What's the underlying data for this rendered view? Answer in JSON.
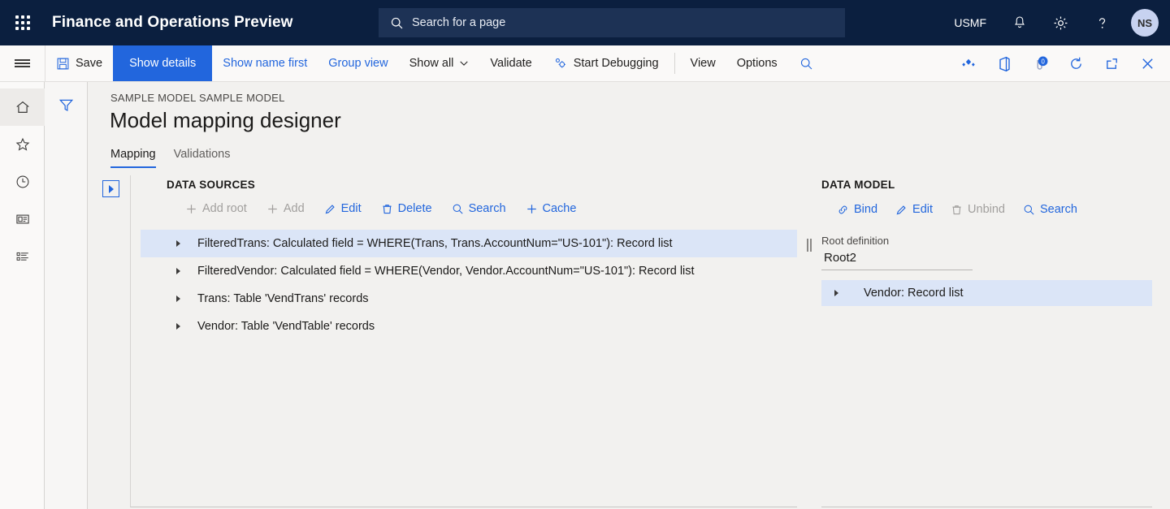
{
  "topbar": {
    "waffle_icon": "app-launcher-icon",
    "app_title": "Finance and Operations Preview",
    "search": {
      "placeholder": "Search for a page",
      "icon": "search-icon"
    },
    "company": "USMF",
    "notifications_icon": "bell-icon",
    "settings_icon": "gear-icon",
    "help_icon": "question-mark-icon",
    "avatar_initials": "NS"
  },
  "commandbar": {
    "menu_icon": "hamburger-menu-icon",
    "save": "Save",
    "show_details": "Show details",
    "show_name_first": "Show name first",
    "group_view": "Group view",
    "show_all": "Show all",
    "validate": "Validate",
    "start_debugging": "Start Debugging",
    "view": "View",
    "options": "Options",
    "search_icon": "search-icon",
    "right_icons": [
      {
        "name": "power-apps-icon"
      },
      {
        "name": "office-app-icon"
      },
      {
        "name": "attachments-icon",
        "badge": "0"
      },
      {
        "name": "refresh-icon"
      },
      {
        "name": "open-in-new-window-icon"
      },
      {
        "name": "close-icon"
      }
    ]
  },
  "navrail": {
    "items": [
      {
        "name": "home-icon",
        "selected": true
      },
      {
        "name": "favorites-star-icon",
        "selected": false
      },
      {
        "name": "recent-clock-icon",
        "selected": false
      },
      {
        "name": "workspaces-icon",
        "selected": false
      },
      {
        "name": "modules-list-icon",
        "selected": false
      }
    ]
  },
  "filterrail": {
    "filter_icon": "filter-funnel-icon"
  },
  "page": {
    "breadcrumb": "SAMPLE MODEL SAMPLE MODEL",
    "title": "Model mapping designer",
    "tabs": [
      {
        "label": "Mapping",
        "selected": true
      },
      {
        "label": "Validations",
        "selected": false
      }
    ]
  },
  "data_sources": {
    "expand_icon": "expand-panel-icon",
    "heading": "DATA SOURCES",
    "toolbar": [
      {
        "label": "Add root",
        "icon": "plus-icon",
        "disabled": true
      },
      {
        "label": "Add",
        "icon": "plus-icon",
        "disabled": true
      },
      {
        "label": "Edit",
        "icon": "pencil-icon",
        "disabled": false
      },
      {
        "label": "Delete",
        "icon": "trash-icon",
        "disabled": false
      },
      {
        "label": "Search",
        "icon": "search-icon",
        "disabled": false
      },
      {
        "label": "Cache",
        "icon": "plus-icon",
        "disabled": false
      }
    ],
    "rows": [
      {
        "label": "FilteredTrans: Calculated field = WHERE(Trans, Trans.AccountNum=\"US-101\"): Record list",
        "selected": true
      },
      {
        "label": "FilteredVendor: Calculated field = WHERE(Vendor, Vendor.AccountNum=\"US-101\"): Record list",
        "selected": false
      },
      {
        "label": "Trans: Table 'VendTrans' records",
        "selected": false
      },
      {
        "label": "Vendor: Table 'VendTable' records",
        "selected": false
      }
    ]
  },
  "splitter": {
    "name": "pane-splitter"
  },
  "data_model": {
    "heading": "DATA MODEL",
    "toolbar": [
      {
        "label": "Bind",
        "icon": "link-icon",
        "disabled": false
      },
      {
        "label": "Edit",
        "icon": "pencil-icon",
        "disabled": false
      },
      {
        "label": "Unbind",
        "icon": "trash-icon",
        "disabled": true
      },
      {
        "label": "Search",
        "icon": "search-icon",
        "disabled": false
      }
    ],
    "root_definition_label": "Root definition",
    "root_definition_value": "Root2",
    "rows": [
      {
        "label": "Vendor: Record list",
        "selected": true
      }
    ]
  },
  "colors": {
    "nav_bg": "#0b1f3f",
    "accent": "#2266dd",
    "selected_row": "#dbe5f7",
    "content_bg": "#f2f1ef"
  }
}
